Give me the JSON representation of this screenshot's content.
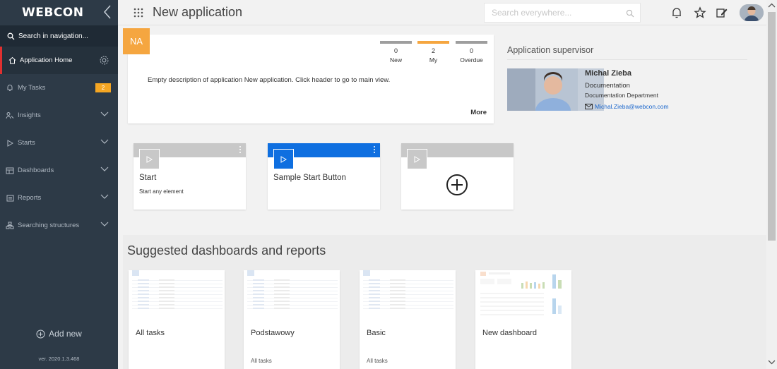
{
  "sidebar": {
    "logo": "WEBCON",
    "search_label": "Search in navigation...",
    "items": [
      {
        "label": "Application Home"
      },
      {
        "label": "My Tasks",
        "badge": "2"
      },
      {
        "label": "Insights"
      },
      {
        "label": "Starts"
      },
      {
        "label": "Dashboards"
      },
      {
        "label": "Reports"
      },
      {
        "label": "Searching structures"
      }
    ],
    "add_new": "Add new",
    "version": "ver. 2020.1.3.468"
  },
  "header": {
    "title": "New application",
    "search_placeholder": "Search everywhere..."
  },
  "summary": {
    "badge": "NA",
    "counters": [
      {
        "value": "0",
        "label": "New"
      },
      {
        "value": "2",
        "label": "My"
      },
      {
        "value": "0",
        "label": "Overdue"
      }
    ],
    "description": "Empty description of application New application. Click header to go to main view.",
    "more_label": "More"
  },
  "supervisor": {
    "title": "Application supervisor",
    "name": "Michal Zieba",
    "role": "Documentation",
    "department": "Documentation Department",
    "email": "Michal.Zieba@webcon.com"
  },
  "start_tiles": [
    {
      "name": "Start",
      "description": "Start any element"
    },
    {
      "name": "Sample Start Button",
      "description": ""
    }
  ],
  "suggested": {
    "title": "Suggested dashboards and reports",
    "cards": [
      {
        "name": "All tasks",
        "subtitle": ""
      },
      {
        "name": "Podstawowy",
        "subtitle": "All tasks"
      },
      {
        "name": "Basic",
        "subtitle": "All tasks"
      },
      {
        "name": "New dashboard",
        "subtitle": ""
      }
    ]
  },
  "colors": {
    "sidebar_bg": "#2d3a47",
    "accent_orange": "#f5a640",
    "accent_blue": "#0f6fe0",
    "active_marker": "#e03030",
    "link_blue": "#1a66cc"
  },
  "icons": {
    "collapse": "chevron-left-icon",
    "search": "search-icon",
    "home": "home-icon",
    "settings": "gear-icon",
    "tasks": "bell-icon",
    "insights": "people-icon",
    "starts": "play-icon",
    "dashboards": "dashboard-icon",
    "reports": "report-icon",
    "structures": "org-structure-icon",
    "notifications": "bell-icon",
    "favorites": "star-icon",
    "edit": "edit-icon",
    "apps": "apps-grid-icon",
    "add": "plus-circle-icon",
    "mail": "envelope-icon"
  }
}
